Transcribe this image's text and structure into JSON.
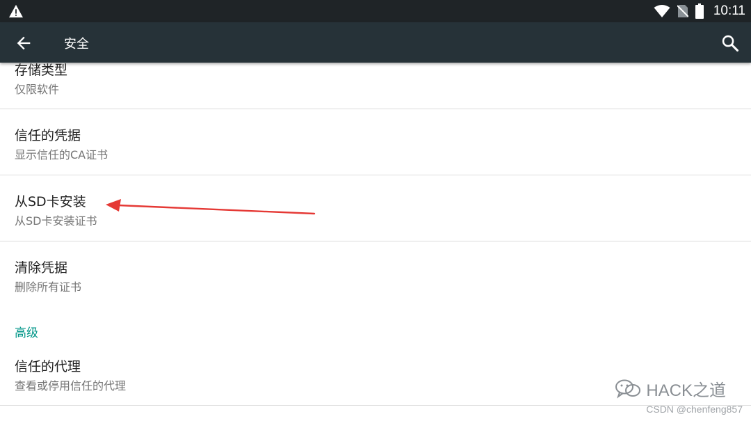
{
  "status_bar": {
    "time": "10:11",
    "icons": [
      "warning-icon",
      "wifi-icon",
      "no-sim-icon",
      "battery-icon"
    ]
  },
  "toolbar": {
    "title": "安全",
    "back_icon": "arrow-back-icon",
    "search_icon": "search-icon"
  },
  "preferences": [
    {
      "title": "存储类型",
      "summary": "仅限软件"
    },
    {
      "title": "信任的凭据",
      "summary": "显示信任的CA证书"
    },
    {
      "title": "从SD卡安装",
      "summary": "从SD卡安装证书"
    },
    {
      "title": "清除凭据",
      "summary": "删除所有证书"
    }
  ],
  "advanced": {
    "category_title": "高级",
    "items": [
      {
        "title": "信任的代理",
        "summary": "查看或停用信任的代理"
      }
    ]
  },
  "annotation": {
    "arrow_color": "#e53935"
  },
  "watermark": {
    "logo_text": "HACK之道",
    "csdn_text": "CSDN @chenfeng857"
  },
  "colors": {
    "status_bar": "#1f2427",
    "toolbar": "#263238",
    "accent": "#009688",
    "primary_text": "#212121",
    "secondary_text": "#757575"
  }
}
